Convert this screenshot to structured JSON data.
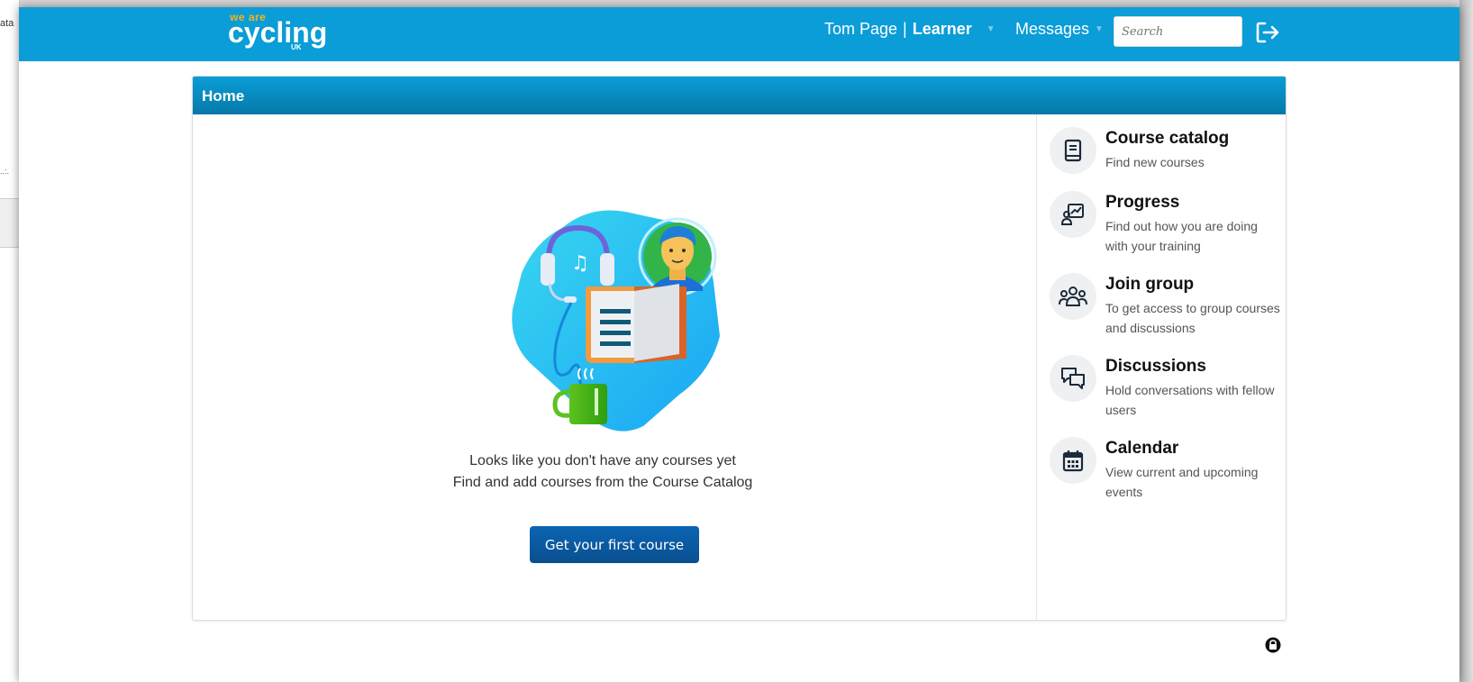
{
  "background": {
    "left_text_1": "ata",
    "left_text_2": "..:."
  },
  "header": {
    "logo": {
      "small": "we are",
      "big": "cycling",
      "uk": "UK"
    },
    "user_name": "Tom Page",
    "separator": "|",
    "user_role": "Learner",
    "messages_label": "Messages",
    "search_placeholder": "Search",
    "logout_icon": "logout-icon",
    "accent_color": "#0a9dd7"
  },
  "main": {
    "title": "Home",
    "empty_state": {
      "line1": "Looks like you don't have any courses yet",
      "line2": "Find and add courses from the Course Catalog",
      "button_label": "Get your first course"
    },
    "shortcuts": [
      {
        "icon": "book-icon",
        "label": "Course catalog",
        "description": "Find new courses"
      },
      {
        "icon": "progress-chart-icon",
        "label": "Progress",
        "description": "Find out how you are doing with your training"
      },
      {
        "icon": "group-icon",
        "label": "Join group",
        "description": "To get access to group courses and discussions"
      },
      {
        "icon": "chat-bubbles-icon",
        "label": "Discussions",
        "description": "Hold conversations with fellow users"
      },
      {
        "icon": "calendar-icon",
        "label": "Calendar",
        "description": "View current and upcoming events"
      }
    ]
  },
  "footer": {
    "lock_icon": "lock-icon"
  }
}
